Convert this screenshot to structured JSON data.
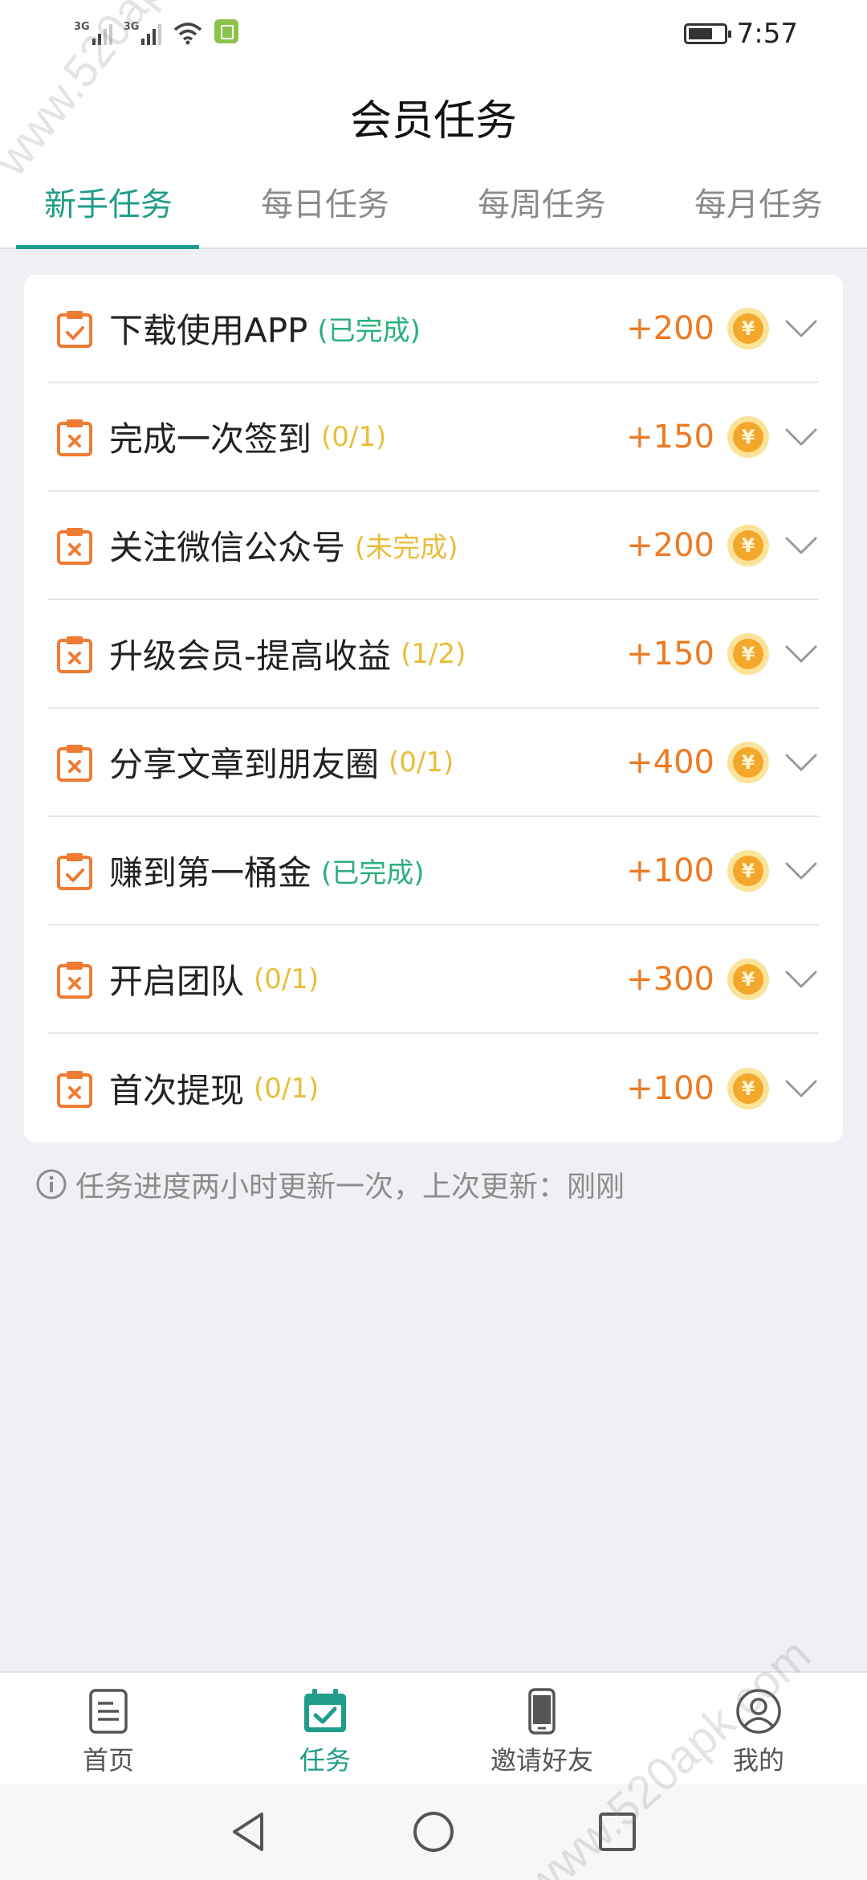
{
  "status_bar": {
    "network_1": "3G",
    "network_2": "3G",
    "time": "7:57",
    "battery_level": 0.7
  },
  "header": {
    "title": "会员任务"
  },
  "tabs": [
    {
      "label": "新手任务",
      "active": true
    },
    {
      "label": "每日任务",
      "active": false
    },
    {
      "label": "每周任务",
      "active": false
    },
    {
      "label": "每月任务",
      "active": false
    }
  ],
  "tasks": [
    {
      "name": "下载使用APP",
      "status": "(已完成)",
      "state": "done",
      "reward": "+200"
    },
    {
      "name": "完成一次签到",
      "status": "(0/1)",
      "state": "todo",
      "reward": "+150"
    },
    {
      "name": "关注微信公众号",
      "status": "(未完成)",
      "state": "todo",
      "reward": "+200"
    },
    {
      "name": "升级会员-提高收益",
      "status": "(1/2)",
      "state": "todo",
      "reward": "+150"
    },
    {
      "name": "分享文章到朋友圈",
      "status": "(0/1)",
      "state": "todo",
      "reward": "+400"
    },
    {
      "name": "赚到第一桶金",
      "status": "(已完成)",
      "state": "done",
      "reward": "+100"
    },
    {
      "name": "开启团队",
      "status": "(0/1)",
      "state": "todo",
      "reward": "+300"
    },
    {
      "name": "首次提现",
      "status": "(0/1)",
      "state": "todo",
      "reward": "+100"
    }
  ],
  "coin_symbol": "¥",
  "note": "任务进度两小时更新一次，上次更新：刚刚",
  "bottom_nav": [
    {
      "label": "首页",
      "icon": "document-icon",
      "active": false
    },
    {
      "label": "任务",
      "icon": "calendar-check-icon",
      "active": true
    },
    {
      "label": "邀请好友",
      "icon": "phone-icon",
      "active": false
    },
    {
      "label": "我的",
      "icon": "user-icon",
      "active": false
    }
  ],
  "watermarks": [
    "www.520apk.com",
    "www.520apk.com"
  ],
  "colors": {
    "accent": "#1f9d8a",
    "reward": "#ee7a22",
    "done": "#2bb07c",
    "todo": "#e8be3a",
    "icon_orange": "#f07b32"
  }
}
